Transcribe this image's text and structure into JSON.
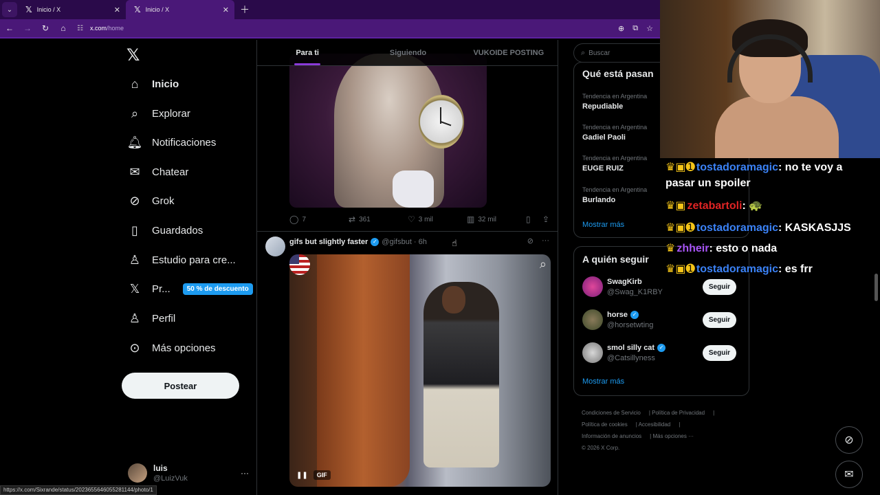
{
  "browser": {
    "tabs": [
      {
        "title": "Inicio / X"
      },
      {
        "title": "Inicio / X"
      }
    ],
    "url_host": "x.com",
    "url_path": "/home",
    "status_url": "https://x.com/Sixrande/status/2023655646055281144/photo/1"
  },
  "nav": {
    "items": [
      {
        "label": "Inicio",
        "icon": "home-icon"
      },
      {
        "label": "Explorar",
        "icon": "search-icon"
      },
      {
        "label": "Notificaciones",
        "icon": "bell-icon"
      },
      {
        "label": "Chatear",
        "icon": "mail-icon"
      },
      {
        "label": "Grok",
        "icon": "grok-icon"
      },
      {
        "label": "Guardados",
        "icon": "bookmark-icon"
      },
      {
        "label": "Estudio para cre...",
        "icon": "creator-studio-icon"
      },
      {
        "label": "Pr...",
        "icon": "x-premium-icon"
      },
      {
        "label": "Perfil",
        "icon": "person-icon"
      },
      {
        "label": "Más opciones",
        "icon": "more-circle-icon"
      }
    ],
    "premium_badge": "50 % de descuento",
    "post_button": "Postear",
    "account": {
      "name": "luis",
      "handle": "@LuizVuk"
    }
  },
  "feed": {
    "tabs": [
      "Para ti",
      "Siguiendo",
      "VUKOIDE POSTING"
    ],
    "post1_actions": {
      "replies": "7",
      "reposts": "361",
      "likes": "3 mil",
      "views": "32 mil"
    },
    "post2": {
      "name": "gifs but slightly faster",
      "handle": "@gifsbut",
      "time": "6h",
      "gif_label": "GIF"
    }
  },
  "sidebar": {
    "search_placeholder": "Buscar",
    "trends_title": "Qué está pasan",
    "trends": [
      {
        "context": "Tendencia en Argentina",
        "topic": "Repudiable"
      },
      {
        "context": "Tendencia en Argentina",
        "topic": "Gadiel Paoli"
      },
      {
        "context": "Tendencia en Argentina",
        "topic": "EUGE RUIZ"
      },
      {
        "context": "Tendencia en Argentina",
        "topic": "Burlando"
      }
    ],
    "show_more": "Mostrar más",
    "who_to_follow_title": "A quién seguir",
    "who_to_follow": [
      {
        "name": "SwagKirb",
        "handle": "@Swag_K1RBY",
        "verified": false
      },
      {
        "name": "horse",
        "handle": "@horsetwting",
        "verified": true
      },
      {
        "name": "smol silly cat",
        "handle": "@Catsillyness",
        "verified": true
      }
    ],
    "follow_label": "Seguir",
    "show_more_2": "Mostrar más",
    "footer": [
      "Condiciones de Servicio",
      "Política de Privacidad",
      "Política de cookies",
      "Accesibilidad",
      "Información de anuncios",
      "Más opciones ···",
      "© 2026 X Corp."
    ]
  },
  "stream_chat": {
    "messages": [
      {
        "user": "tostadoramagic",
        "text": "no te voy a pasar un spoiler"
      },
      {
        "user": "zetabartoli",
        "text": ""
      },
      {
        "user": "tostadoramagic",
        "text": "KASKASJJS"
      },
      {
        "user": "zhheir",
        "text": "esto o nada"
      },
      {
        "user": "tostadoramagic",
        "text": "es frr"
      }
    ]
  },
  "colors": {
    "browser_accent": "#4a1878",
    "x_blue": "#1d9bf0",
    "tab_indicator": "#8b3ad9"
  }
}
